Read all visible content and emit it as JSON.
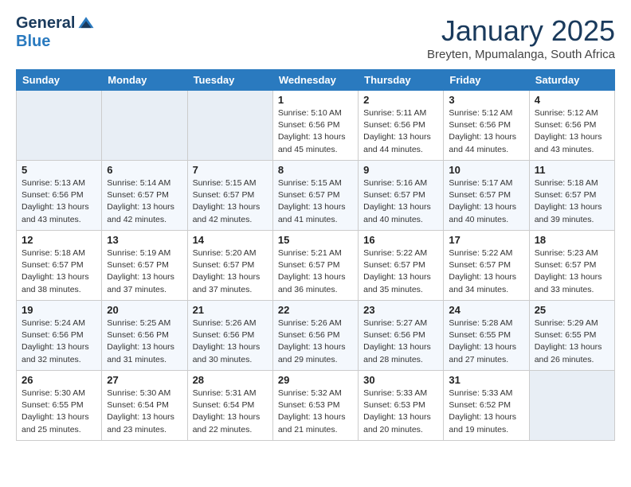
{
  "header": {
    "logo_general": "General",
    "logo_blue": "Blue",
    "month": "January 2025",
    "location": "Breyten, Mpumalanga, South Africa"
  },
  "weekdays": [
    "Sunday",
    "Monday",
    "Tuesday",
    "Wednesday",
    "Thursday",
    "Friday",
    "Saturday"
  ],
  "weeks": [
    [
      {
        "day": "",
        "info": ""
      },
      {
        "day": "",
        "info": ""
      },
      {
        "day": "",
        "info": ""
      },
      {
        "day": "1",
        "info": "Sunrise: 5:10 AM\nSunset: 6:56 PM\nDaylight: 13 hours\nand 45 minutes."
      },
      {
        "day": "2",
        "info": "Sunrise: 5:11 AM\nSunset: 6:56 PM\nDaylight: 13 hours\nand 44 minutes."
      },
      {
        "day": "3",
        "info": "Sunrise: 5:12 AM\nSunset: 6:56 PM\nDaylight: 13 hours\nand 44 minutes."
      },
      {
        "day": "4",
        "info": "Sunrise: 5:12 AM\nSunset: 6:56 PM\nDaylight: 13 hours\nand 43 minutes."
      }
    ],
    [
      {
        "day": "5",
        "info": "Sunrise: 5:13 AM\nSunset: 6:56 PM\nDaylight: 13 hours\nand 43 minutes."
      },
      {
        "day": "6",
        "info": "Sunrise: 5:14 AM\nSunset: 6:57 PM\nDaylight: 13 hours\nand 42 minutes."
      },
      {
        "day": "7",
        "info": "Sunrise: 5:15 AM\nSunset: 6:57 PM\nDaylight: 13 hours\nand 42 minutes."
      },
      {
        "day": "8",
        "info": "Sunrise: 5:15 AM\nSunset: 6:57 PM\nDaylight: 13 hours\nand 41 minutes."
      },
      {
        "day": "9",
        "info": "Sunrise: 5:16 AM\nSunset: 6:57 PM\nDaylight: 13 hours\nand 40 minutes."
      },
      {
        "day": "10",
        "info": "Sunrise: 5:17 AM\nSunset: 6:57 PM\nDaylight: 13 hours\nand 40 minutes."
      },
      {
        "day": "11",
        "info": "Sunrise: 5:18 AM\nSunset: 6:57 PM\nDaylight: 13 hours\nand 39 minutes."
      }
    ],
    [
      {
        "day": "12",
        "info": "Sunrise: 5:18 AM\nSunset: 6:57 PM\nDaylight: 13 hours\nand 38 minutes."
      },
      {
        "day": "13",
        "info": "Sunrise: 5:19 AM\nSunset: 6:57 PM\nDaylight: 13 hours\nand 37 minutes."
      },
      {
        "day": "14",
        "info": "Sunrise: 5:20 AM\nSunset: 6:57 PM\nDaylight: 13 hours\nand 37 minutes."
      },
      {
        "day": "15",
        "info": "Sunrise: 5:21 AM\nSunset: 6:57 PM\nDaylight: 13 hours\nand 36 minutes."
      },
      {
        "day": "16",
        "info": "Sunrise: 5:22 AM\nSunset: 6:57 PM\nDaylight: 13 hours\nand 35 minutes."
      },
      {
        "day": "17",
        "info": "Sunrise: 5:22 AM\nSunset: 6:57 PM\nDaylight: 13 hours\nand 34 minutes."
      },
      {
        "day": "18",
        "info": "Sunrise: 5:23 AM\nSunset: 6:57 PM\nDaylight: 13 hours\nand 33 minutes."
      }
    ],
    [
      {
        "day": "19",
        "info": "Sunrise: 5:24 AM\nSunset: 6:56 PM\nDaylight: 13 hours\nand 32 minutes."
      },
      {
        "day": "20",
        "info": "Sunrise: 5:25 AM\nSunset: 6:56 PM\nDaylight: 13 hours\nand 31 minutes."
      },
      {
        "day": "21",
        "info": "Sunrise: 5:26 AM\nSunset: 6:56 PM\nDaylight: 13 hours\nand 30 minutes."
      },
      {
        "day": "22",
        "info": "Sunrise: 5:26 AM\nSunset: 6:56 PM\nDaylight: 13 hours\nand 29 minutes."
      },
      {
        "day": "23",
        "info": "Sunrise: 5:27 AM\nSunset: 6:56 PM\nDaylight: 13 hours\nand 28 minutes."
      },
      {
        "day": "24",
        "info": "Sunrise: 5:28 AM\nSunset: 6:55 PM\nDaylight: 13 hours\nand 27 minutes."
      },
      {
        "day": "25",
        "info": "Sunrise: 5:29 AM\nSunset: 6:55 PM\nDaylight: 13 hours\nand 26 minutes."
      }
    ],
    [
      {
        "day": "26",
        "info": "Sunrise: 5:30 AM\nSunset: 6:55 PM\nDaylight: 13 hours\nand 25 minutes."
      },
      {
        "day": "27",
        "info": "Sunrise: 5:30 AM\nSunset: 6:54 PM\nDaylight: 13 hours\nand 23 minutes."
      },
      {
        "day": "28",
        "info": "Sunrise: 5:31 AM\nSunset: 6:54 PM\nDaylight: 13 hours\nand 22 minutes."
      },
      {
        "day": "29",
        "info": "Sunrise: 5:32 AM\nSunset: 6:53 PM\nDaylight: 13 hours\nand 21 minutes."
      },
      {
        "day": "30",
        "info": "Sunrise: 5:33 AM\nSunset: 6:53 PM\nDaylight: 13 hours\nand 20 minutes."
      },
      {
        "day": "31",
        "info": "Sunrise: 5:33 AM\nSunset: 6:52 PM\nDaylight: 13 hours\nand 19 minutes."
      },
      {
        "day": "",
        "info": ""
      }
    ]
  ]
}
